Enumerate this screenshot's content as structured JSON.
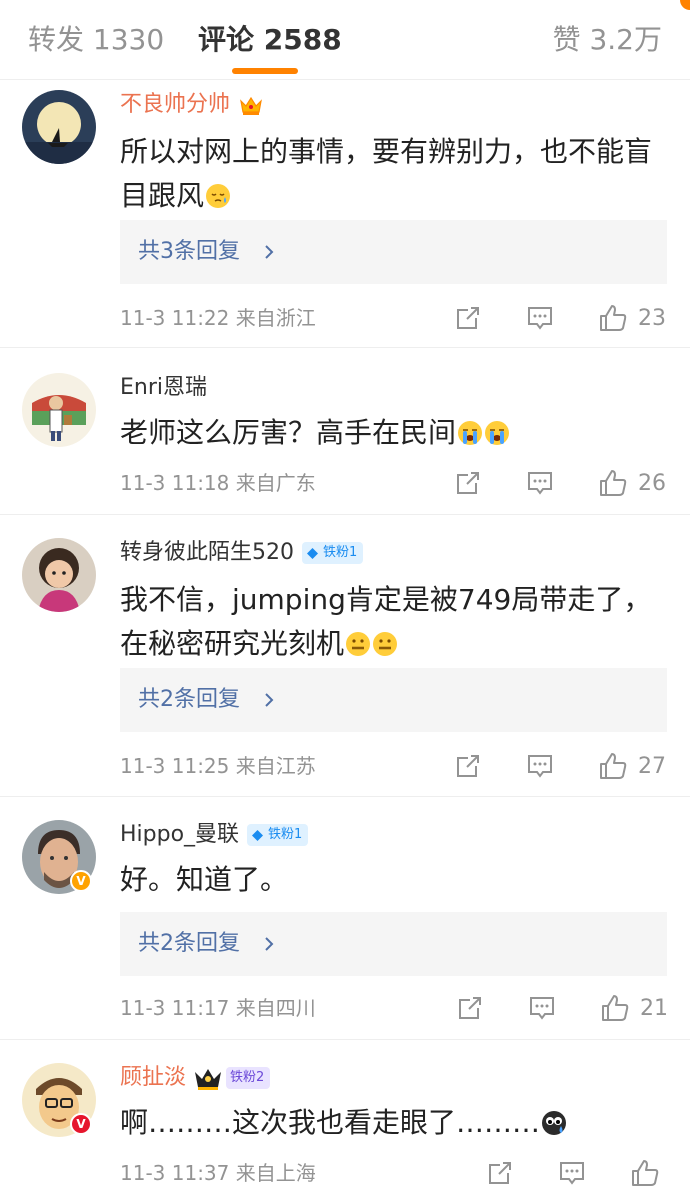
{
  "tabs": {
    "repost": "转发 1330",
    "comments": "评论 2588",
    "likes": "赞 3.2万"
  },
  "colors": {
    "accent": "#ff8200",
    "link": "#5170a6",
    "vip_name": "#eb7350",
    "fan_badge": "#1a8cf0"
  },
  "comments": [
    {
      "username": "不良帅分帅",
      "badge": "vip-crown-icon",
      "line1": "所以对网上的事情，要有辨别力，也不能盲",
      "line2": "目跟风",
      "emoji2": "sleepy-face-emoji",
      "replies": "共3条回复",
      "time": "11-3 11:22",
      "source": "来自浙江",
      "likes": "23"
    },
    {
      "username": "Enri恩瑞",
      "line1": "老师这么厉害？高手在民间",
      "emoji1": "loudly-crying-face-emoji",
      "time": "11-3 11:18",
      "source": "来自广东",
      "likes": "26"
    },
    {
      "username": "转身彼此陌生520",
      "fan_badge": "铁粉1",
      "line1": "我不信，jumping肯定是被749局带走了，",
      "line2": "在秘密研究光刻机",
      "emoji2": "zipper-mouth-face-emoji",
      "replies": "共2条回复",
      "time": "11-3 11:25",
      "source": "来自江苏",
      "likes": "27"
    },
    {
      "username": "Hippo_曼联",
      "fan_badge": "铁粉1",
      "verified": "yellow-v-icon",
      "line1": "好。知道了。",
      "replies": "共2条回复",
      "time": "11-3 11:17",
      "source": "来自四川",
      "likes": "21"
    },
    {
      "username": "顾扯淡",
      "fan_badge": "铁粉2",
      "verified": "red-v-icon",
      "line1": "啊………这次我也看走眼了………",
      "emoji1": "sweat-face-emoji",
      "time": "11-3 11:37",
      "source": "来自上海",
      "likes": ""
    }
  ]
}
